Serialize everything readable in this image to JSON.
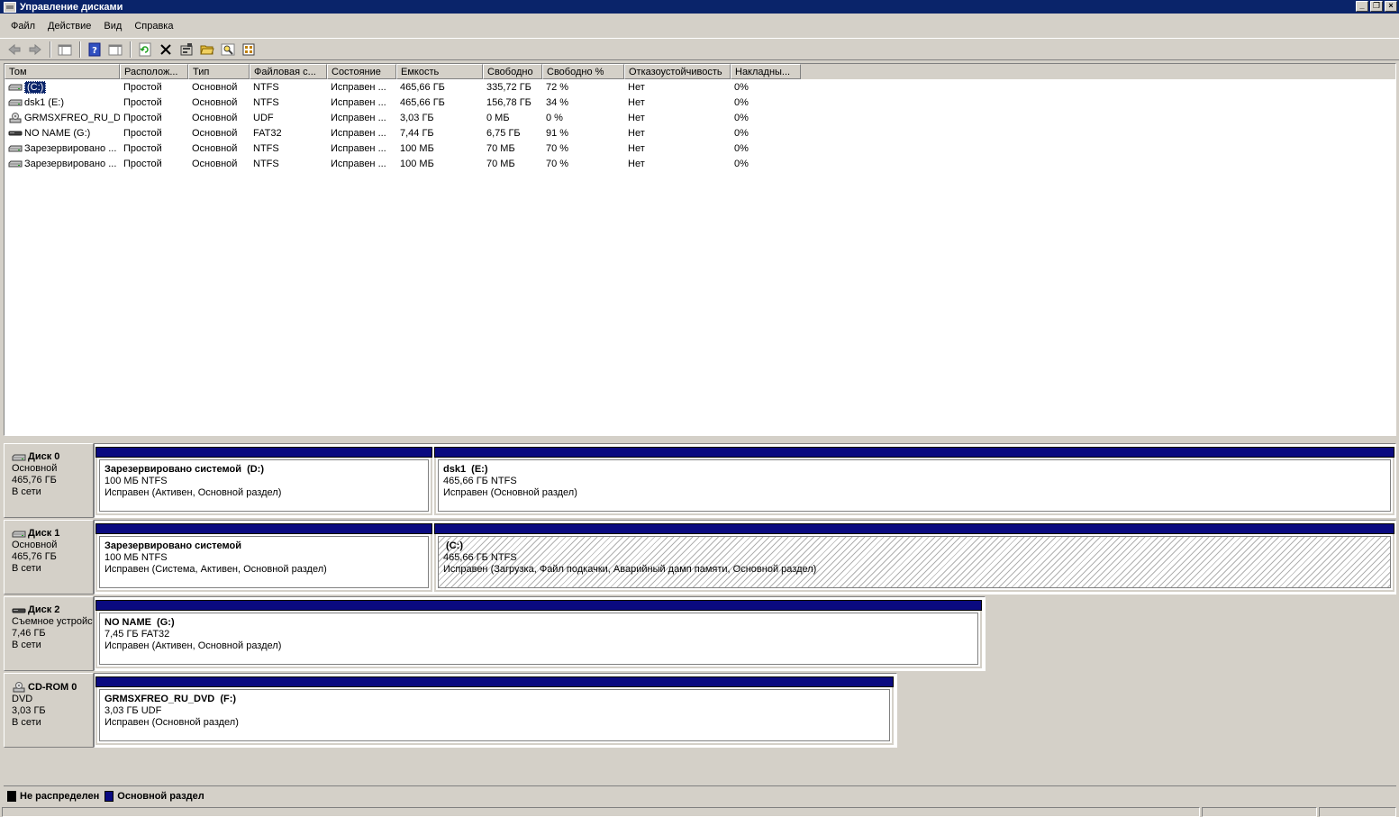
{
  "window": {
    "title": "Управление дисками"
  },
  "menu": {
    "items": [
      "Файл",
      "Действие",
      "Вид",
      "Справка"
    ]
  },
  "toolbar": {
    "buttons": [
      "back-arrow-icon",
      "forward-arrow-icon",
      "console-tree-icon",
      "help-icon",
      "action-pane-icon",
      "refresh-icon",
      "delete-icon",
      "properties-icon",
      "open-folder-icon",
      "search-icon",
      "export-list-icon"
    ]
  },
  "volume_list": {
    "columns": [
      "Том",
      "Располож...",
      "Тип",
      "Файловая с...",
      "Состояние",
      "Емкость",
      "Свободно",
      "Свободно %",
      "Отказоустойчивость",
      "Накладны..."
    ],
    "rows": [
      {
        "icon": "hdd-icon",
        "name": "(C:)",
        "selected": true,
        "layout": "Простой",
        "type": "Основной",
        "fs": "NTFS",
        "status": "Исправен ...",
        "capacity": "465,66 ГБ",
        "free": "335,72 ГБ",
        "free_pct": "72 %",
        "fault": "Нет",
        "overhead": "0%"
      },
      {
        "icon": "hdd-icon",
        "name": "dsk1 (E:)",
        "selected": false,
        "layout": "Простой",
        "type": "Основной",
        "fs": "NTFS",
        "status": "Исправен ...",
        "capacity": "465,66 ГБ",
        "free": "156,78 ГБ",
        "free_pct": "34 %",
        "fault": "Нет",
        "overhead": "0%"
      },
      {
        "icon": "cdrom-icon",
        "name": "GRMSXFREO_RU_D...",
        "selected": false,
        "layout": "Простой",
        "type": "Основной",
        "fs": "UDF",
        "status": "Исправен ...",
        "capacity": "3,03 ГБ",
        "free": "0 МБ",
        "free_pct": "0 %",
        "fault": "Нет",
        "overhead": "0%"
      },
      {
        "icon": "usb-drive-icon",
        "name": "NO NAME (G:)",
        "selected": false,
        "layout": "Простой",
        "type": "Основной",
        "fs": "FAT32",
        "status": "Исправен ...",
        "capacity": "7,44 ГБ",
        "free": "6,75 ГБ",
        "free_pct": "91 %",
        "fault": "Нет",
        "overhead": "0%"
      },
      {
        "icon": "hdd-icon",
        "name": "Зарезервировано ...",
        "selected": false,
        "layout": "Простой",
        "type": "Основной",
        "fs": "NTFS",
        "status": "Исправен ...",
        "capacity": "100 МБ",
        "free": "70 МБ",
        "free_pct": "70 %",
        "fault": "Нет",
        "overhead": "0%"
      },
      {
        "icon": "hdd-icon",
        "name": "Зарезервировано ...",
        "selected": false,
        "layout": "Простой",
        "type": "Основной",
        "fs": "NTFS",
        "status": "Исправен ...",
        "capacity": "100 МБ",
        "free": "70 МБ",
        "free_pct": "70 %",
        "fault": "Нет",
        "overhead": "0%"
      }
    ]
  },
  "disks": [
    {
      "icon": "hdd-icon",
      "name": "Диск 0",
      "kind": "Основной",
      "size": "465,76 ГБ",
      "state": "В сети",
      "partitions": [
        {
          "title": "Зарезервировано системой  (D:)",
          "line1": "100 МБ NTFS",
          "line2": "Исправен (Активен, Основной раздел)",
          "hatched": false
        },
        {
          "title": "dsk1  (E:)",
          "line1": "465,66 ГБ NTFS",
          "line2": "Исправен (Основной раздел)",
          "hatched": false
        }
      ]
    },
    {
      "icon": "hdd-icon",
      "name": "Диск 1",
      "kind": "Основной",
      "size": "465,76 ГБ",
      "state": "В сети",
      "partitions": [
        {
          "title": "Зарезервировано системой",
          "line1": "100 МБ NTFS",
          "line2": "Исправен (Система, Активен, Основной раздел)",
          "hatched": false
        },
        {
          "title": " (C:)",
          "line1": "465,66 ГБ NTFS",
          "line2": "Исправен (Загрузка, Файл подкачки, Аварийный дамп памяти, Основной раздел)",
          "hatched": true
        }
      ]
    },
    {
      "icon": "usb-drive-icon",
      "name": "Диск 2",
      "kind": "Съемное устройство",
      "size": "7,46 ГБ",
      "state": "В сети",
      "partitions": [
        {
          "title": "NO NAME  (G:)",
          "line1": "7,45 ГБ FAT32",
          "line2": "Исправен (Активен, Основной раздел)",
          "hatched": false
        }
      ]
    },
    {
      "icon": "cdrom-icon",
      "name": "CD-ROM 0",
      "kind": "DVD",
      "size": "3,03 ГБ",
      "state": "В сети",
      "partitions": [
        {
          "title": "GRMSXFREO_RU_DVD  (F:)",
          "line1": "3,03 ГБ UDF",
          "line2": "Исправен (Основной раздел)",
          "hatched": false
        }
      ]
    }
  ],
  "legend": [
    {
      "label": "Не распределен",
      "color": "#000000"
    },
    {
      "label": "Основной раздел",
      "color": "#0a0a80"
    }
  ]
}
